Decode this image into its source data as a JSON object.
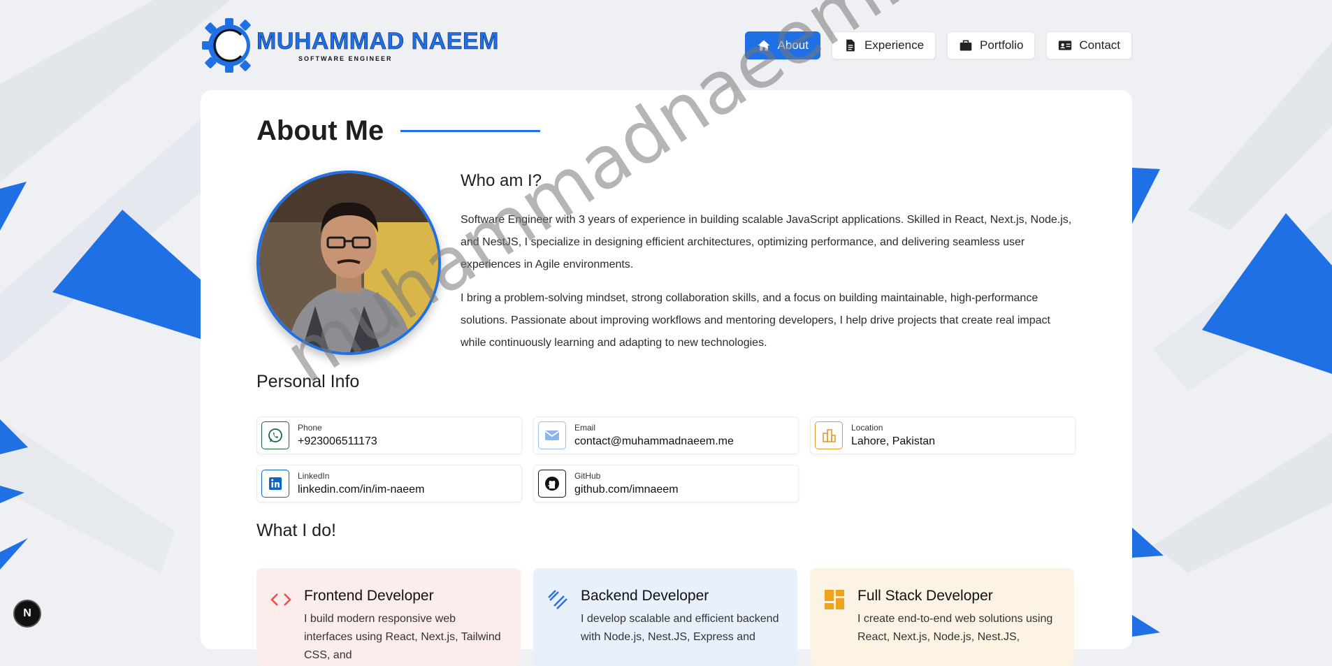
{
  "brand": {
    "name": "MUHAMMAD NAEEM",
    "subtitle": "SOFTWARE ENGINEER"
  },
  "nav": {
    "items": [
      {
        "label": "About",
        "icon": "home-icon",
        "active": true
      },
      {
        "label": "Experience",
        "icon": "document-icon",
        "active": false
      },
      {
        "label": "Portfolio",
        "icon": "briefcase-icon",
        "active": false
      },
      {
        "label": "Contact",
        "icon": "contact-card-icon",
        "active": false
      }
    ]
  },
  "about": {
    "title": "About Me",
    "who_heading": "Who am I?",
    "paragraphs": [
      "Software Engineer with 3 years of experience in building scalable JavaScript applications. Skilled in React, Next.js, Node.js, and NestJS, I specialize in designing efficient architectures, optimizing performance, and delivering seamless user experiences in Agile environments.",
      "I bring a problem-solving mindset, strong collaboration skills, and a focus on building maintainable, high-performance solutions. Passionate about improving workflows and mentoring developers, I help drive projects that create real impact while continuously learning and adapting to new technologies."
    ]
  },
  "personal_info": {
    "heading": "Personal Info",
    "items": [
      {
        "label": "Phone",
        "value": "+923006511173",
        "icon": "whatsapp-icon"
      },
      {
        "label": "Email",
        "value": "contact@muhammadnaeem.me",
        "icon": "mail-icon"
      },
      {
        "label": "Location",
        "value": "Lahore, Pakistan",
        "icon": "city-icon"
      },
      {
        "label": "LinkedIn",
        "value": "linkedin.com/in/im-naeem",
        "icon": "linkedin-icon"
      },
      {
        "label": "GitHub",
        "value": "github.com/imnaeem",
        "icon": "github-icon"
      }
    ]
  },
  "services": {
    "heading": "What I do!",
    "items": [
      {
        "title": "Frontend Developer",
        "text": "I build modern responsive web interfaces using React, Next.js, Tailwind CSS, and",
        "icon": "code-icon"
      },
      {
        "title": "Backend Developer",
        "text": "I develop scalable and efficient backend with Node.js, Nest.JS, Express and",
        "icon": "backend-icon"
      },
      {
        "title": "Full Stack Developer",
        "text": "I create end-to-end web solutions using React, Next.js, Node.js, Nest.JS,",
        "icon": "dashboard-icon"
      }
    ]
  },
  "watermark": "muhammadnaeem.me",
  "next_badge": "N",
  "colors": {
    "accent": "#1f6fe5",
    "whatsapp": "#1b6b3a",
    "mail": "#6b9be8",
    "location": "#e69a2a",
    "linkedin": "#0a66c2",
    "frontend_bg": "#fdecec",
    "backend_bg": "#e8f0fb",
    "fullstack_bg": "#fdf3e4"
  }
}
